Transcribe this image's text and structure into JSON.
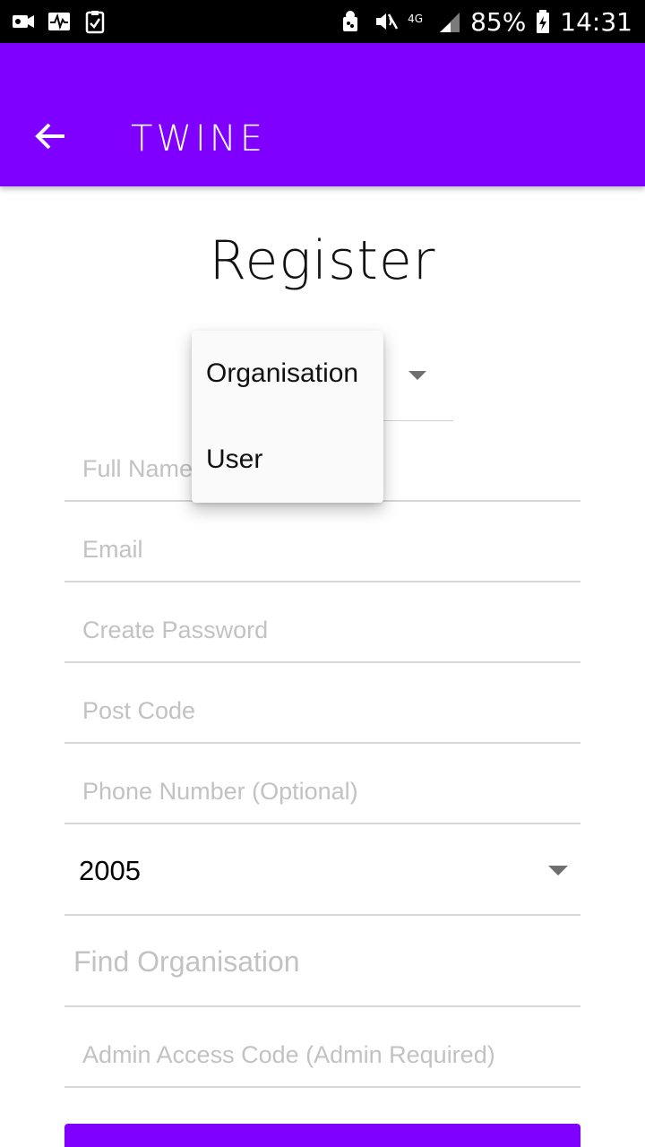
{
  "status_bar": {
    "battery": "85%",
    "time": "14:31",
    "network": "4G",
    "icons": [
      "camera-icon",
      "activity-icon",
      "clipboard-check-icon",
      "android-icon",
      "mute-icon",
      "network-4g-icon",
      "signal-icon",
      "battery-charging-icon"
    ]
  },
  "app_bar": {
    "title": "TWINE",
    "back_icon": "arrow-left-icon",
    "color": "#7f00ff"
  },
  "page": {
    "title": "Register"
  },
  "role_menu": {
    "items": [
      "Organisation",
      "User"
    ]
  },
  "form": {
    "full_name_placeholder": "Full Name",
    "email_placeholder": "Email",
    "password_placeholder": "Create Password",
    "postcode_placeholder": "Post Code",
    "phone_placeholder": "Phone Number (Optional)",
    "year_value": "2005",
    "find_org_placeholder": "Find Organisation",
    "admin_code_placeholder": "Admin Access Code (Admin Required)"
  },
  "colors": {
    "accent": "#7f00ff",
    "placeholder": "#c2c2c2",
    "divider": "#d6d6d6"
  }
}
